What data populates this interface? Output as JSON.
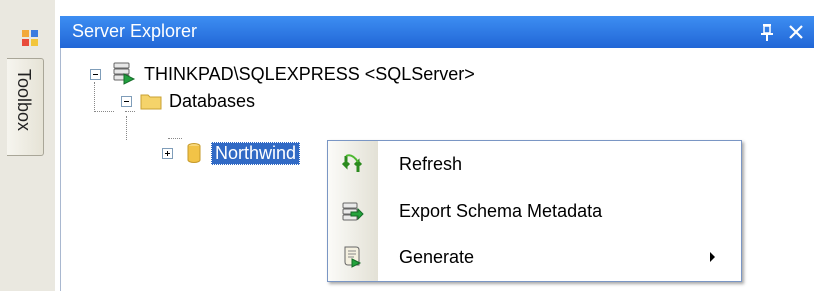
{
  "toolbox": {
    "label": "Toolbox"
  },
  "panel": {
    "title": "Server Explorer",
    "pin_glyph": "ᵽ",
    "close_glyph": "✕"
  },
  "tree": {
    "server": {
      "label": "THINKPAD\\SQLEXPRESS <SQLServer>",
      "icon": "server-icon",
      "expanded": true
    },
    "databases": {
      "label": "Databases",
      "icon": "folder-icon",
      "expanded": true
    },
    "northwind": {
      "label": "Northwind",
      "icon": "database-icon",
      "expanded": false,
      "selected": true
    }
  },
  "context_menu": {
    "items": [
      {
        "label": "Refresh",
        "icon": "refresh-icon",
        "has_submenu": false
      },
      {
        "label": "Export Schema Metadata",
        "icon": "export-icon",
        "has_submenu": false
      },
      {
        "label": "Generate",
        "icon": "generate-icon",
        "has_submenu": true
      }
    ]
  },
  "colors": {
    "title_bar": "#2a76e4",
    "selection": "#316ac5",
    "menu_border": "#7a96c4"
  }
}
